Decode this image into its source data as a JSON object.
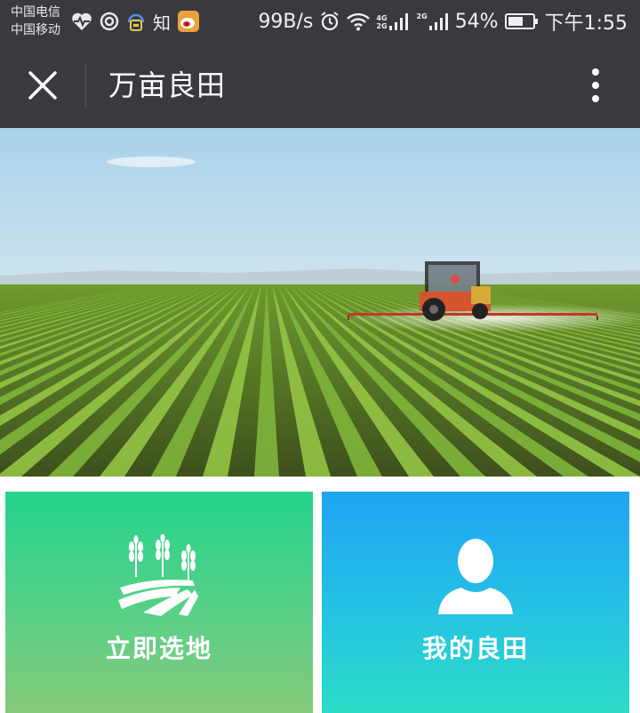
{
  "status_bar": {
    "carrier_1": "中国电信",
    "carrier_2": "中国移动",
    "zhihu_glyph": "知",
    "net_speed": "99B/s",
    "net_tag_1": "4G",
    "net_tag_2": "2G",
    "net_tag_3": "2G",
    "battery": "54%",
    "time": "下午1:55",
    "icons": [
      "heart-rate-icon",
      "swirl-app-icon",
      "headset-assistant-icon",
      "zhihu-icon",
      "weibo-icon",
      "alarm-icon",
      "wifi-icon",
      "signal-4g-icon",
      "signal-2g-icon",
      "battery-icon"
    ]
  },
  "app_bar": {
    "title": "万亩良田",
    "close_icon": "close-icon",
    "more_icon": "more-vertical-icon"
  },
  "banner": {
    "scene": "farm-field-tractor-photo"
  },
  "tiles": [
    {
      "label": "立即选地",
      "icon": "wheat-field-icon",
      "color_top": "#24d38d",
      "color_bottom": "#86c97a"
    },
    {
      "label": "我的良田",
      "icon": "user-silhouette-icon",
      "color_top": "#1fa4f3",
      "color_bottom": "#2ddcc6"
    }
  ],
  "colors": {
    "bar_background": "#393a3f",
    "text_light": "#ffffff"
  }
}
